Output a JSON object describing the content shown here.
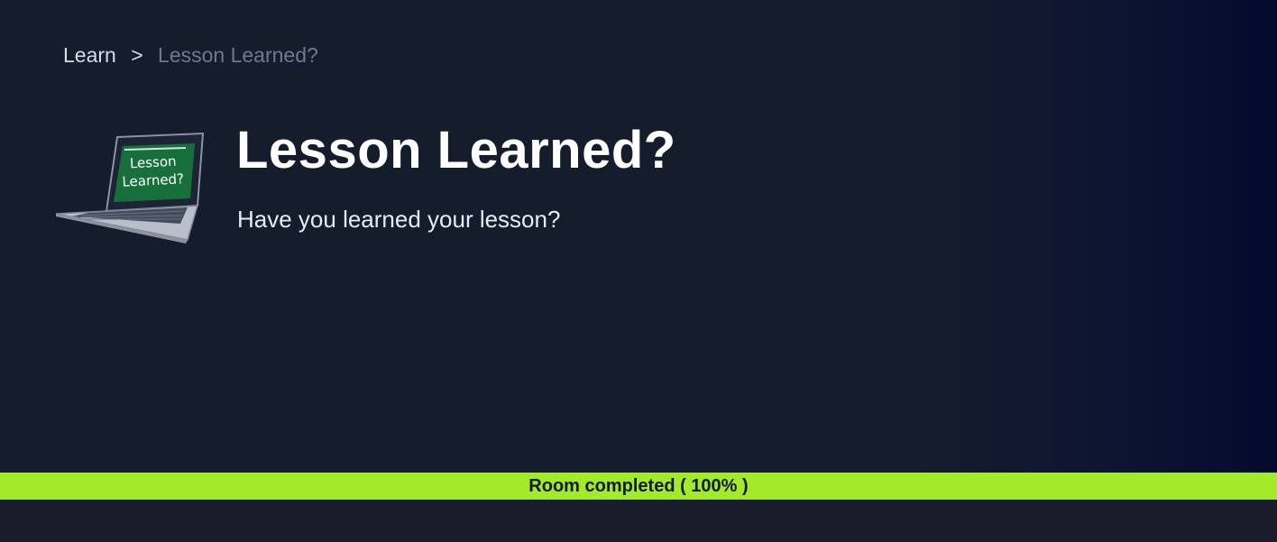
{
  "breadcrumb": {
    "root": "Learn",
    "separator": ">",
    "current": "Lesson Learned?"
  },
  "room": {
    "title": "Lesson Learned?",
    "subtitle": "Have you learned your lesson?",
    "icon": "laptop-icon",
    "icon_screen_text_line1": "Lesson",
    "icon_screen_text_line2": "Learned?"
  },
  "progress": {
    "label": "Room completed ( 100% )",
    "percent": 100,
    "color": "#a3ea2a"
  },
  "colors": {
    "background": "#151c2c",
    "gradient_end": "#020b2e",
    "title": "#ffffff",
    "breadcrumb_current": "#6f7891"
  }
}
